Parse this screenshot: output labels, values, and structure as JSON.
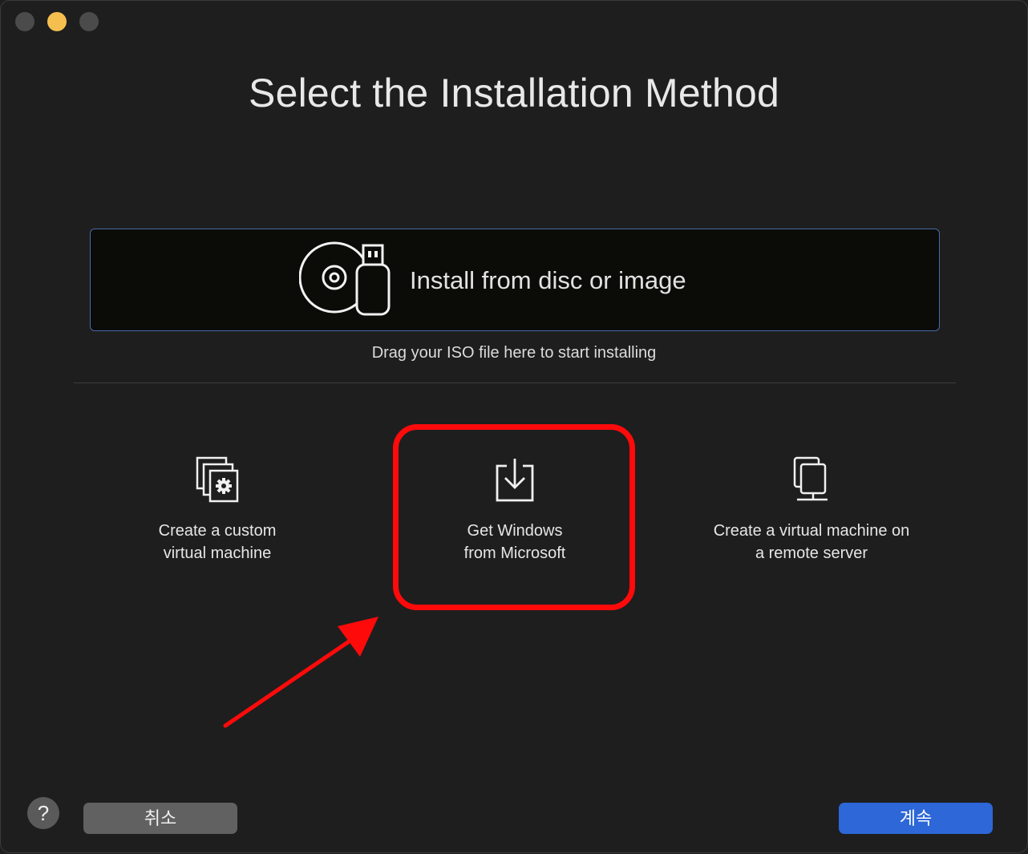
{
  "window": {
    "traffic_lights": [
      "close",
      "minimize",
      "zoom"
    ]
  },
  "title": "Select the Installation Method",
  "install_from_disc": {
    "label": "Install from disc or image",
    "icon": "disc-usb-icon",
    "hint": "Drag your ISO file here to start installing"
  },
  "options": [
    {
      "label": "Create a custom\nvirtual machine",
      "icon": "custom-vm-gear-icon"
    },
    {
      "label": "Get Windows\nfrom Microsoft",
      "icon": "download-icon"
    },
    {
      "label": "Create a virtual machine on\na remote server",
      "icon": "remote-server-icon"
    }
  ],
  "footer": {
    "help_label": "?",
    "cancel_label": "취소",
    "continue_label": "계속"
  },
  "colors": {
    "accent_blue": "#2d67d8",
    "highlight_red": "#ff0a0a",
    "background": "#1e1e1e"
  }
}
